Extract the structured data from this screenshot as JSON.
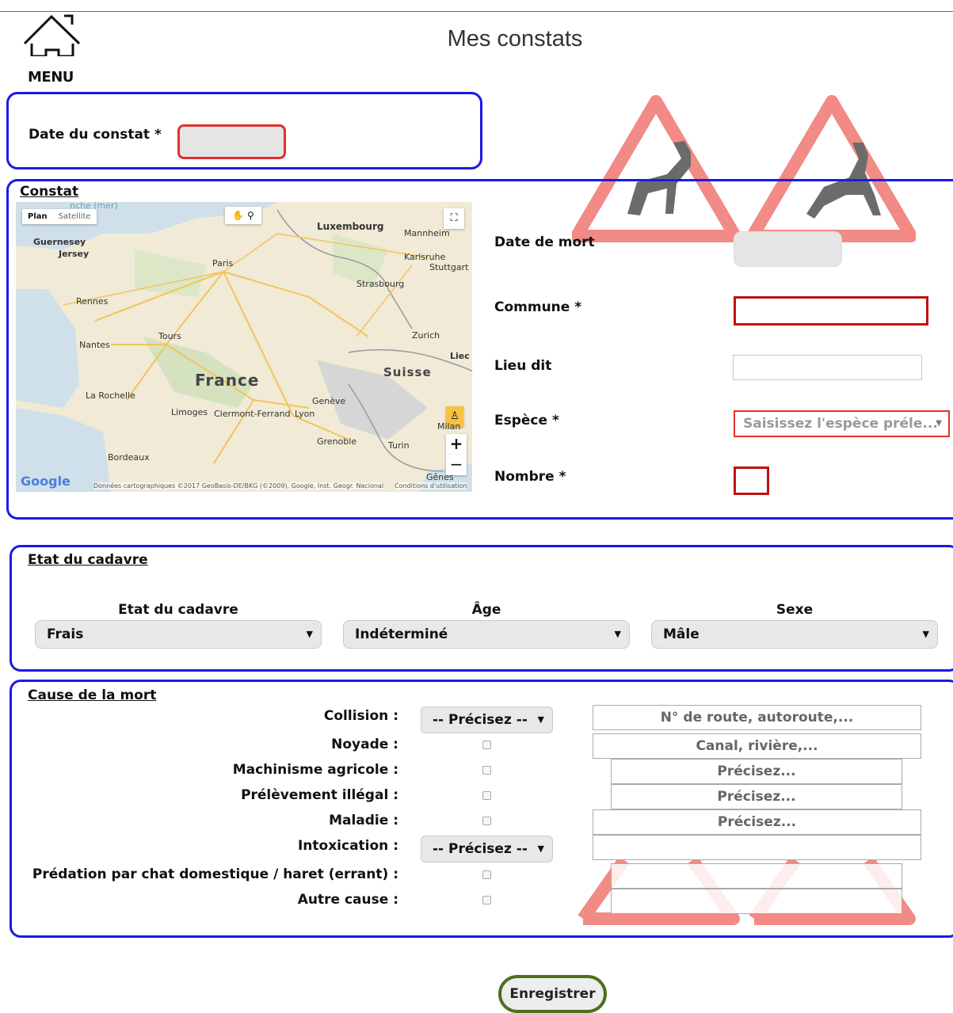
{
  "header": {
    "title": "Mes constats",
    "menu_label": "MENU"
  },
  "date_section": {
    "label": "Date du constat *"
  },
  "constat": {
    "section_title": "Constat",
    "fields": {
      "date_mort": "Date de mort",
      "commune": "Commune *",
      "lieu_dit": "Lieu dit",
      "espece": "Espèce *",
      "espece_placeholder": "Saisissez l'espèce préle...",
      "nombre": "Nombre *"
    },
    "map": {
      "type_plan": "Plan",
      "type_satellite": "Satellite",
      "zoom_in": "+",
      "zoom_out": "−",
      "google": "Google",
      "attribution": "Données cartographiques ©2017 GeoBasis-DE/BKG (©2009), Google, Inst. Geogr. Nacional",
      "terms": "Conditions d'utilisation",
      "labels": {
        "guernesey": "Guernesey",
        "jersey": "Jersey",
        "paris": "Paris",
        "rennes": "Rennes",
        "tours": "Tours",
        "nantes": "Nantes",
        "france": "France",
        "la_rochelle": "La Rochelle",
        "limoges": "Limoges",
        "clermont": "Clermont-Ferrand",
        "lyon": "Lyon",
        "geneve": "Genève",
        "grenoble": "Grenoble",
        "turin": "Turin",
        "bordeaux": "Bordeaux",
        "genes": "Gênes",
        "milan": "Milan",
        "suisse": "Suisse",
        "zurich": "Zurich",
        "strasbourg": "Strasbourg",
        "stuttgart": "Stuttgart",
        "karlsruhe": "Karlsruhe",
        "mannheim": "Mannheim",
        "luxembourg": "Luxembourg",
        "liec": "Liec",
        "manche": "nche (mer)"
      }
    }
  },
  "etat": {
    "section_title": "Etat du cadavre",
    "etat_label": "Etat du cadavre",
    "etat_value": "Frais",
    "age_label": "Âge",
    "age_value": "Indéterminé",
    "sexe_label": "Sexe",
    "sexe_value": "Mâle"
  },
  "cause": {
    "section_title": "Cause de la mort",
    "collision": "Collision :",
    "collision_select": "-- Précisez --",
    "collision_placeholder": "N° de route, autoroute,...",
    "noyade": "Noyade :",
    "noyade_placeholder": "Canal, rivière,...",
    "machinisme": "Machinisme agricole :",
    "machinisme_placeholder": "Précisez...",
    "prelevement": "Prélèvement illégal :",
    "prelevement_placeholder": "Précisez...",
    "maladie": "Maladie :",
    "maladie_placeholder": "Précisez...",
    "intoxication": "Intoxication :",
    "intoxication_select": "-- Précisez --",
    "predation": "Prédation par chat domestique / haret (errant) :",
    "autre": "Autre cause :"
  },
  "actions": {
    "save": "Enregistrer"
  },
  "colors": {
    "section_border": "#1a1ae6",
    "required_border": "#e03030",
    "save_border": "#4e6e1e"
  }
}
